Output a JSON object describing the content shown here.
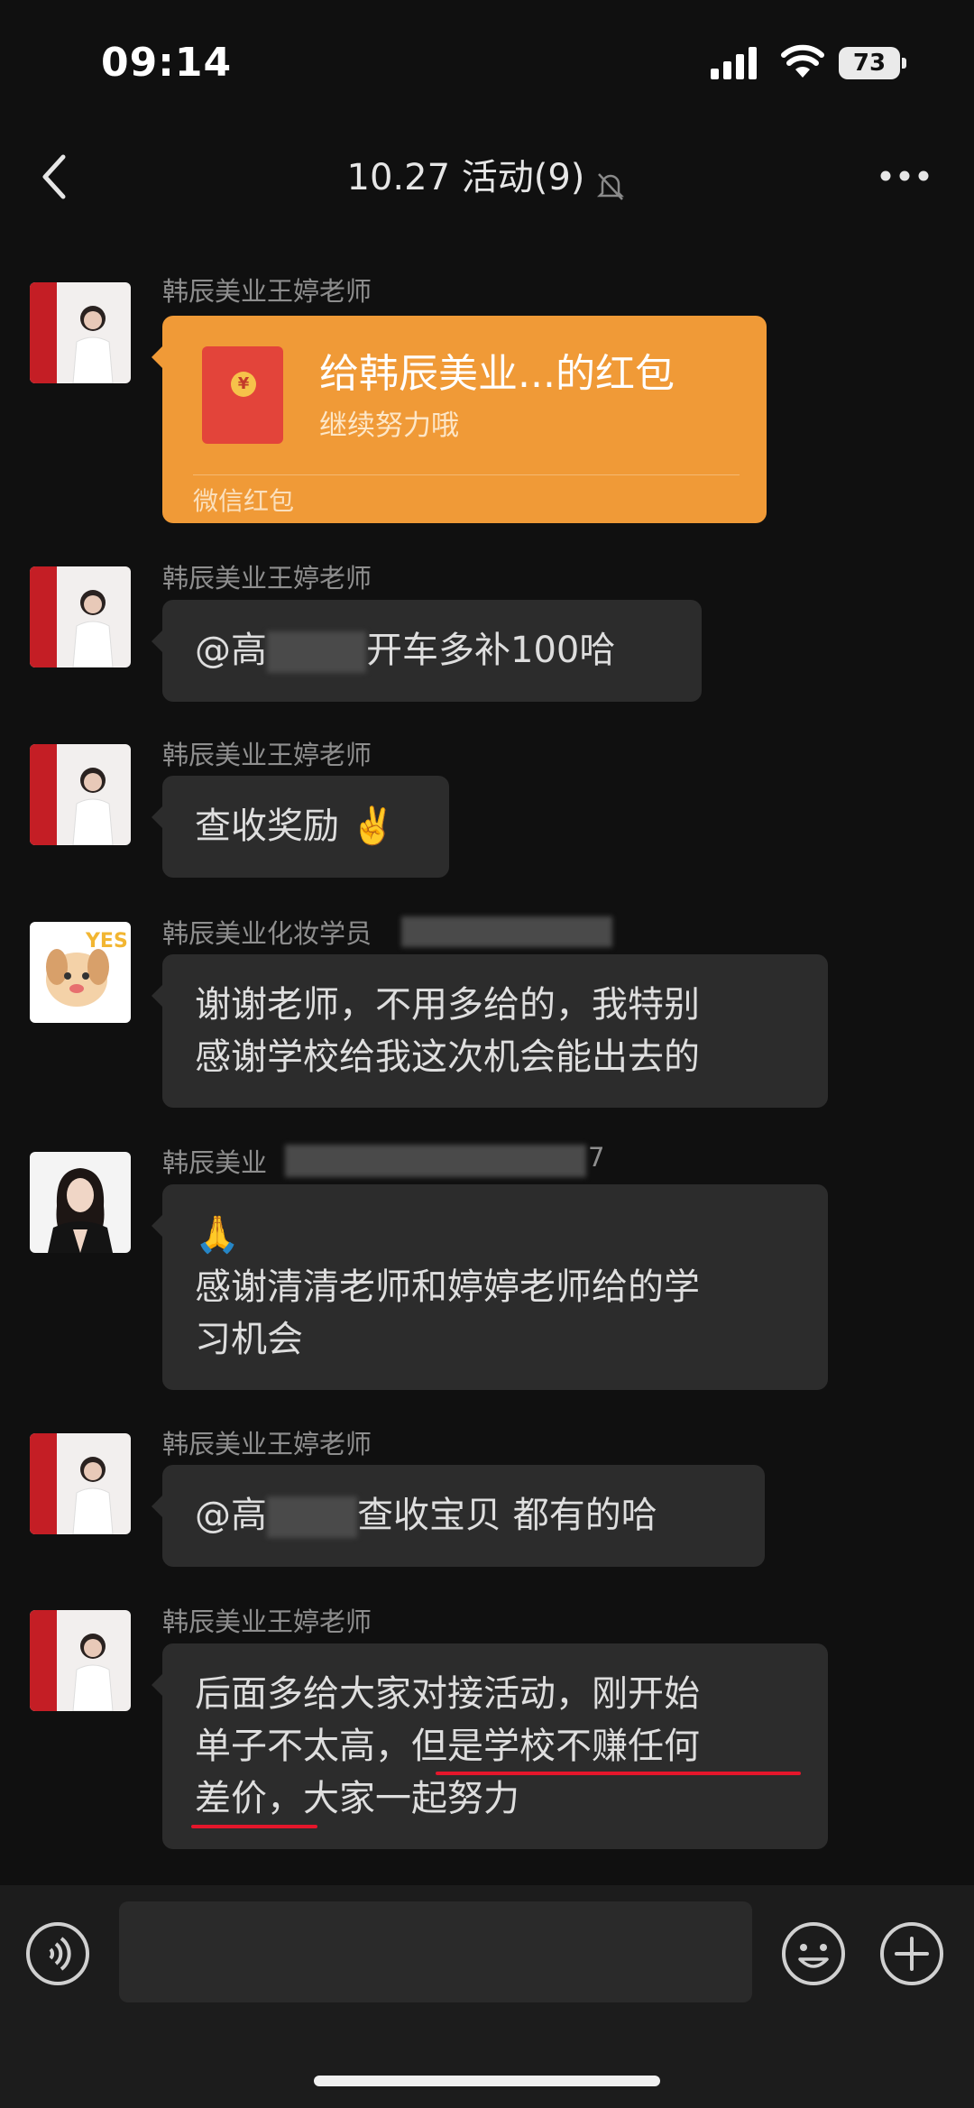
{
  "status": {
    "time": "09:14",
    "battery": "73"
  },
  "header": {
    "title": "10.27  活动(9)",
    "back_icon": "chevron-left-icon",
    "mute_icon": "bell-off-icon",
    "more_icon": "ellipsis-icon"
  },
  "messages": [
    {
      "sender": "韩辰美业王婷老师",
      "type": "red_packet",
      "title": "给韩辰美业...的红包",
      "subtitle": "继续努力哦",
      "footer": "微信红包"
    },
    {
      "sender": "韩辰美业王婷老师",
      "text_prefix": "@高",
      "text_suffix": "开车多补100哈"
    },
    {
      "sender": "韩辰美业王婷老师",
      "text": "查收奖励",
      "emoji": "✌️"
    },
    {
      "sender": "韩辰美业化妆学员",
      "lines": [
        "谢谢老师，不用多给的，我特别",
        "感谢学校给我这次机会能出去的"
      ]
    },
    {
      "sender_prefix": "韩辰美业",
      "sender_suffix": "7",
      "emoji": "🙏",
      "lines": [
        "感谢清清老师和婷婷老师给的学",
        "习机会"
      ]
    },
    {
      "sender": "韩辰美业王婷老师",
      "text_prefix": "@高",
      "text_suffix": "查收宝贝 都有的哈"
    },
    {
      "sender": "韩辰美业王婷老师",
      "lines": [
        "后面多给大家对接活动，刚开始",
        "单子不太高，但是学校不赚任何",
        "差价，大家一起努力"
      ]
    }
  ],
  "input": {
    "voice_icon": "voice-icon",
    "emoji_icon": "smiley-icon",
    "plus_icon": "plus-circle-icon"
  },
  "colors": {
    "background": "#101010",
    "bubble": "#2c2c2c",
    "red_packet": "#f09a37",
    "underline": "#e5162b"
  }
}
